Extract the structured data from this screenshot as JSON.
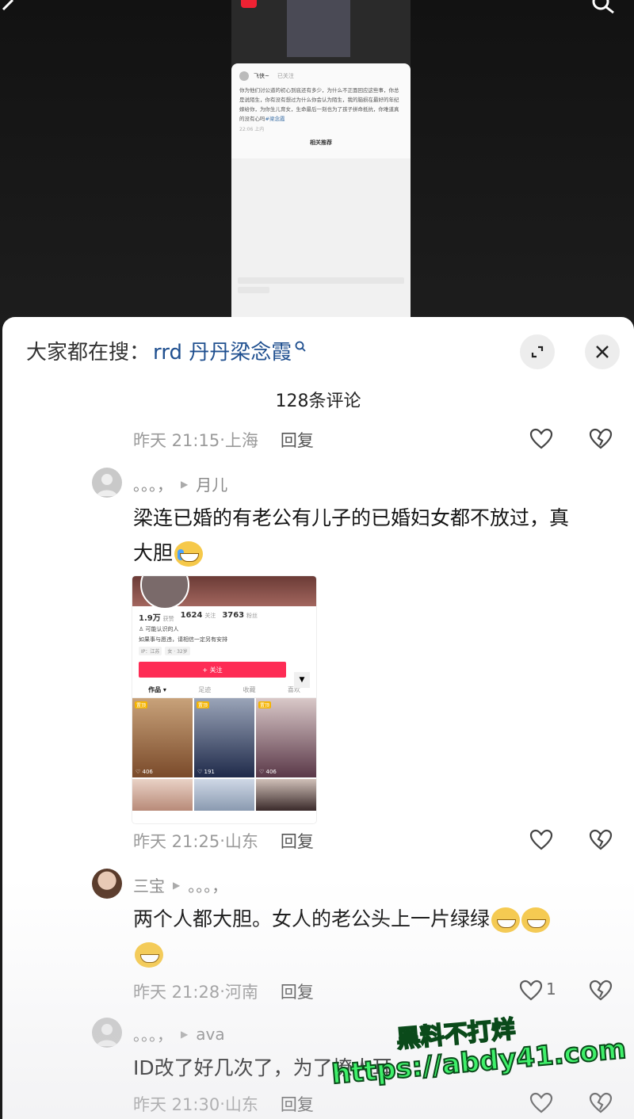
{
  "search": {
    "label": "大家都在搜：",
    "keyword": "rrd 丹丹梁念霞"
  },
  "comments_count": "128条评论",
  "mini_post": {
    "author": "飞侠~",
    "follow_status": "已关注",
    "text": "你为他们讨公道的初心到底还有多少，为什么不正面回应这些事，你总是说陌生，你有没有想过为什么你会认为陌生，我的脑损在最好的年纪嫁给你，为你生儿育女，生命最后一刻也为了孩子拼命抵抗，你难道真的没有心吗",
    "tag": "#梁念霞",
    "meta": "22:06 上内",
    "related": "相关推荐"
  },
  "comments": [
    {
      "time": "昨天 21:15",
      "location": "上海",
      "reply": "回复"
    },
    {
      "user": "。。。，",
      "reply_to": "月儿",
      "text_line1": "梁连已婚的有老公有儿子的已婚妇女都不放过，真",
      "text_line2": "大胆",
      "time": "昨天 21:25",
      "location": "山东",
      "reply": "回复",
      "image": {
        "stats": [
          {
            "value": "1.9万",
            "label": "获赞"
          },
          {
            "value": "1624",
            "label": "关注"
          },
          {
            "value": "3763",
            "label": "粉丝"
          }
        ],
        "line1": "可能认识的人",
        "line2": "如果事与愿违，请相信一定另有安排",
        "tags": [
          "IP：江苏",
          "女 · 32岁"
        ],
        "follow": "+ 关注",
        "tabs": [
          "作品 ▾",
          "足迹",
          "收藏",
          "喜欢"
        ],
        "cells": [
          {
            "pin": "置顶",
            "count": "406",
            "color": "#8a5a3a"
          },
          {
            "pin": "置顶",
            "count": "191",
            "color": "#2e3f6b"
          },
          {
            "pin": "置顶",
            "count": "406",
            "color": "#6a5060"
          }
        ]
      }
    },
    {
      "user": "三宝",
      "reply_to": "。。。，",
      "text_line1": "两个人都大胆。女人的老公头上一片绿绿",
      "time": "昨天 21:28",
      "location": "河南",
      "reply": "回复",
      "likes": "1"
    },
    {
      "user": "。。。，",
      "reply_to": "ava",
      "text_line1": "ID改了好几次了，为了撩人耳",
      "time": "昨天 21:30",
      "location": "山东",
      "reply": "回复"
    }
  ],
  "watermark": {
    "line1": "黑料不打烊",
    "line2": "https://abdy41.com"
  },
  "colors": {
    "keyword": "#1f4f8f",
    "follow_button": "#fe2c55",
    "watermark": "#3ff06a"
  }
}
